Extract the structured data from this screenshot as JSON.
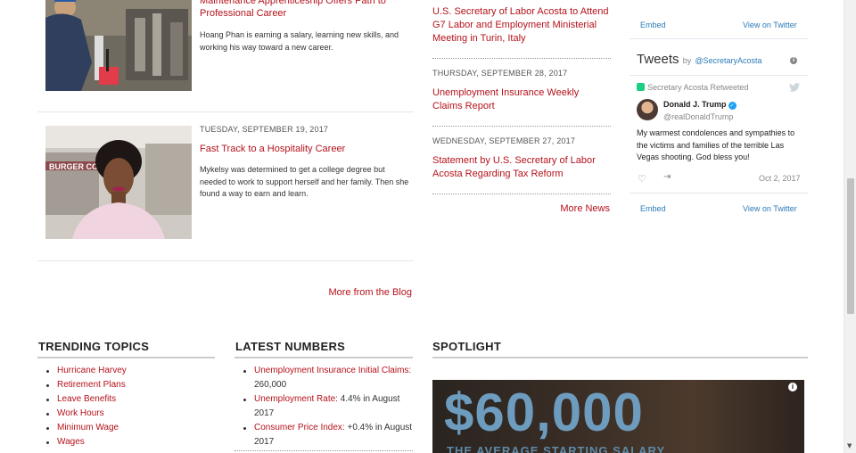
{
  "blog": {
    "items": [
      {
        "title": "Maintenance Apprenticeship Offers Path to Professional Career",
        "title_line1": "Maintenance Apprenticeship Offers Path to",
        "title_line2": "Professional Career",
        "description": "Hoang Phan is earning a salary, learning new skills, and working his way toward a new career."
      },
      {
        "date": "TUESDAY, SEPTEMBER 19, 2017",
        "title": "Fast Track to a Hospitality Career",
        "description": "Mykelsy was determined to get a college degree but needed to work to support herself and her family. Then she found a way to earn and learn."
      }
    ],
    "more_label": "More from the Blog",
    "photo_sign": "BURGER COMI"
  },
  "news": {
    "items": [
      {
        "title": "U.S. Secretary of Labor Acosta to Attend G7 Labor and Employment Ministerial Meeting in Turin, Italy"
      },
      {
        "date": "THURSDAY, SEPTEMBER 28, 2017",
        "title": "Unemployment Insurance Weekly Claims Report"
      },
      {
        "date": "WEDNESDAY, SEPTEMBER 27, 2017",
        "title": "Statement by U.S. Secretary of Labor Acosta Regarding Tax Reform"
      }
    ],
    "more_label": "More News"
  },
  "twitter": {
    "embed_label": "Embed",
    "view_label": "View on Twitter",
    "header_title": "Tweets",
    "header_by": "by",
    "header_handle": "@SecretaryAcosta",
    "retweet_label": "Secretary Acosta Retweeted",
    "author_name": "Donald J. Trump",
    "author_handle": "@realDonaldTrump",
    "tweet_text": "My warmest condolences and sympathies to the victims and families of the terrible Las Vegas shooting. God bless you!",
    "tweet_date": "Oct 2, 2017",
    "accent_color": "#2b7bb9"
  },
  "trending": {
    "heading": "TRENDING TOPICS",
    "items": [
      "Hurricane Harvey",
      "Retirement Plans",
      "Leave Benefits",
      "Work Hours",
      "Minimum Wage",
      "Wages"
    ]
  },
  "numbers": {
    "heading": "LATEST NUMBERS",
    "items": [
      {
        "label": "Unemployment Insurance Initial Claims:",
        "value": "260,000"
      },
      {
        "label": "Unemployment Rate:",
        "value": "4.4% in August 2017"
      },
      {
        "label": "Consumer Price Index:",
        "value": "+0.4% in August 2017"
      }
    ]
  },
  "spotlight": {
    "heading": "SPOTLIGHT",
    "big_text": "$60,000",
    "sub_text": "THE AVERAGE STARTING SALARY"
  },
  "colors": {
    "link": "#b5121b",
    "twitter_link": "#2b7bb9"
  }
}
